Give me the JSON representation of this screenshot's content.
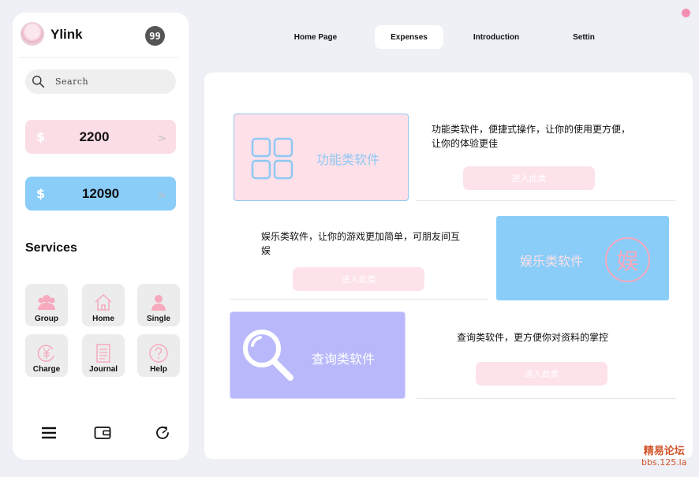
{
  "window": {
    "close_color": "#f48fb1"
  },
  "sidebar": {
    "app_name": "Ylink",
    "badge": "99",
    "search_placeholder": "Search",
    "balances": [
      {
        "currency": "$",
        "amount": "2200",
        "color": "#fbdde6"
      },
      {
        "currency": "$",
        "amount": "12090",
        "color": "#89cdf8"
      }
    ],
    "arrow": ">",
    "services_title": "Services",
    "services": [
      {
        "label": "Group",
        "icon": "group-icon"
      },
      {
        "label": "Home",
        "icon": "home-icon"
      },
      {
        "label": "Single",
        "icon": "user-icon"
      },
      {
        "label": "Charge",
        "icon": "yen-refresh-icon"
      },
      {
        "label": "Journal",
        "icon": "document-icon"
      },
      {
        "label": "Help",
        "icon": "help-icon"
      }
    ],
    "bottom_icons": [
      "menu-icon",
      "wallet-icon",
      "refresh-icon"
    ]
  },
  "tabs": [
    {
      "label": "Home Page",
      "active": false
    },
    {
      "label": "Expenses",
      "active": true
    },
    {
      "label": "Introduction",
      "active": false
    },
    {
      "label": "Settin",
      "active": false
    }
  ],
  "categories": [
    {
      "title": "功能类软件",
      "description": "功能类软件，便捷式操作，让你的使用更方便，让你的体验更佳",
      "button": "进入此类",
      "color": "#fde0e8",
      "icon": "grid-icon"
    },
    {
      "title": "娱乐类软件",
      "description": "娱乐类软件，让你的游戏更加简单，可朋友间互娱",
      "button": "进入此类",
      "color": "#89cdf8",
      "icon": "entertainment-badge-icon",
      "badge_char": "娱"
    },
    {
      "title": "查询类软件",
      "description": "查询类软件，更方便你对资料的掌控",
      "button": "进入此类",
      "color": "#b8b8fb",
      "icon": "magnifier-icon"
    }
  ],
  "watermark": {
    "line1": "精易论坛",
    "line2": "bbs.125.la"
  }
}
